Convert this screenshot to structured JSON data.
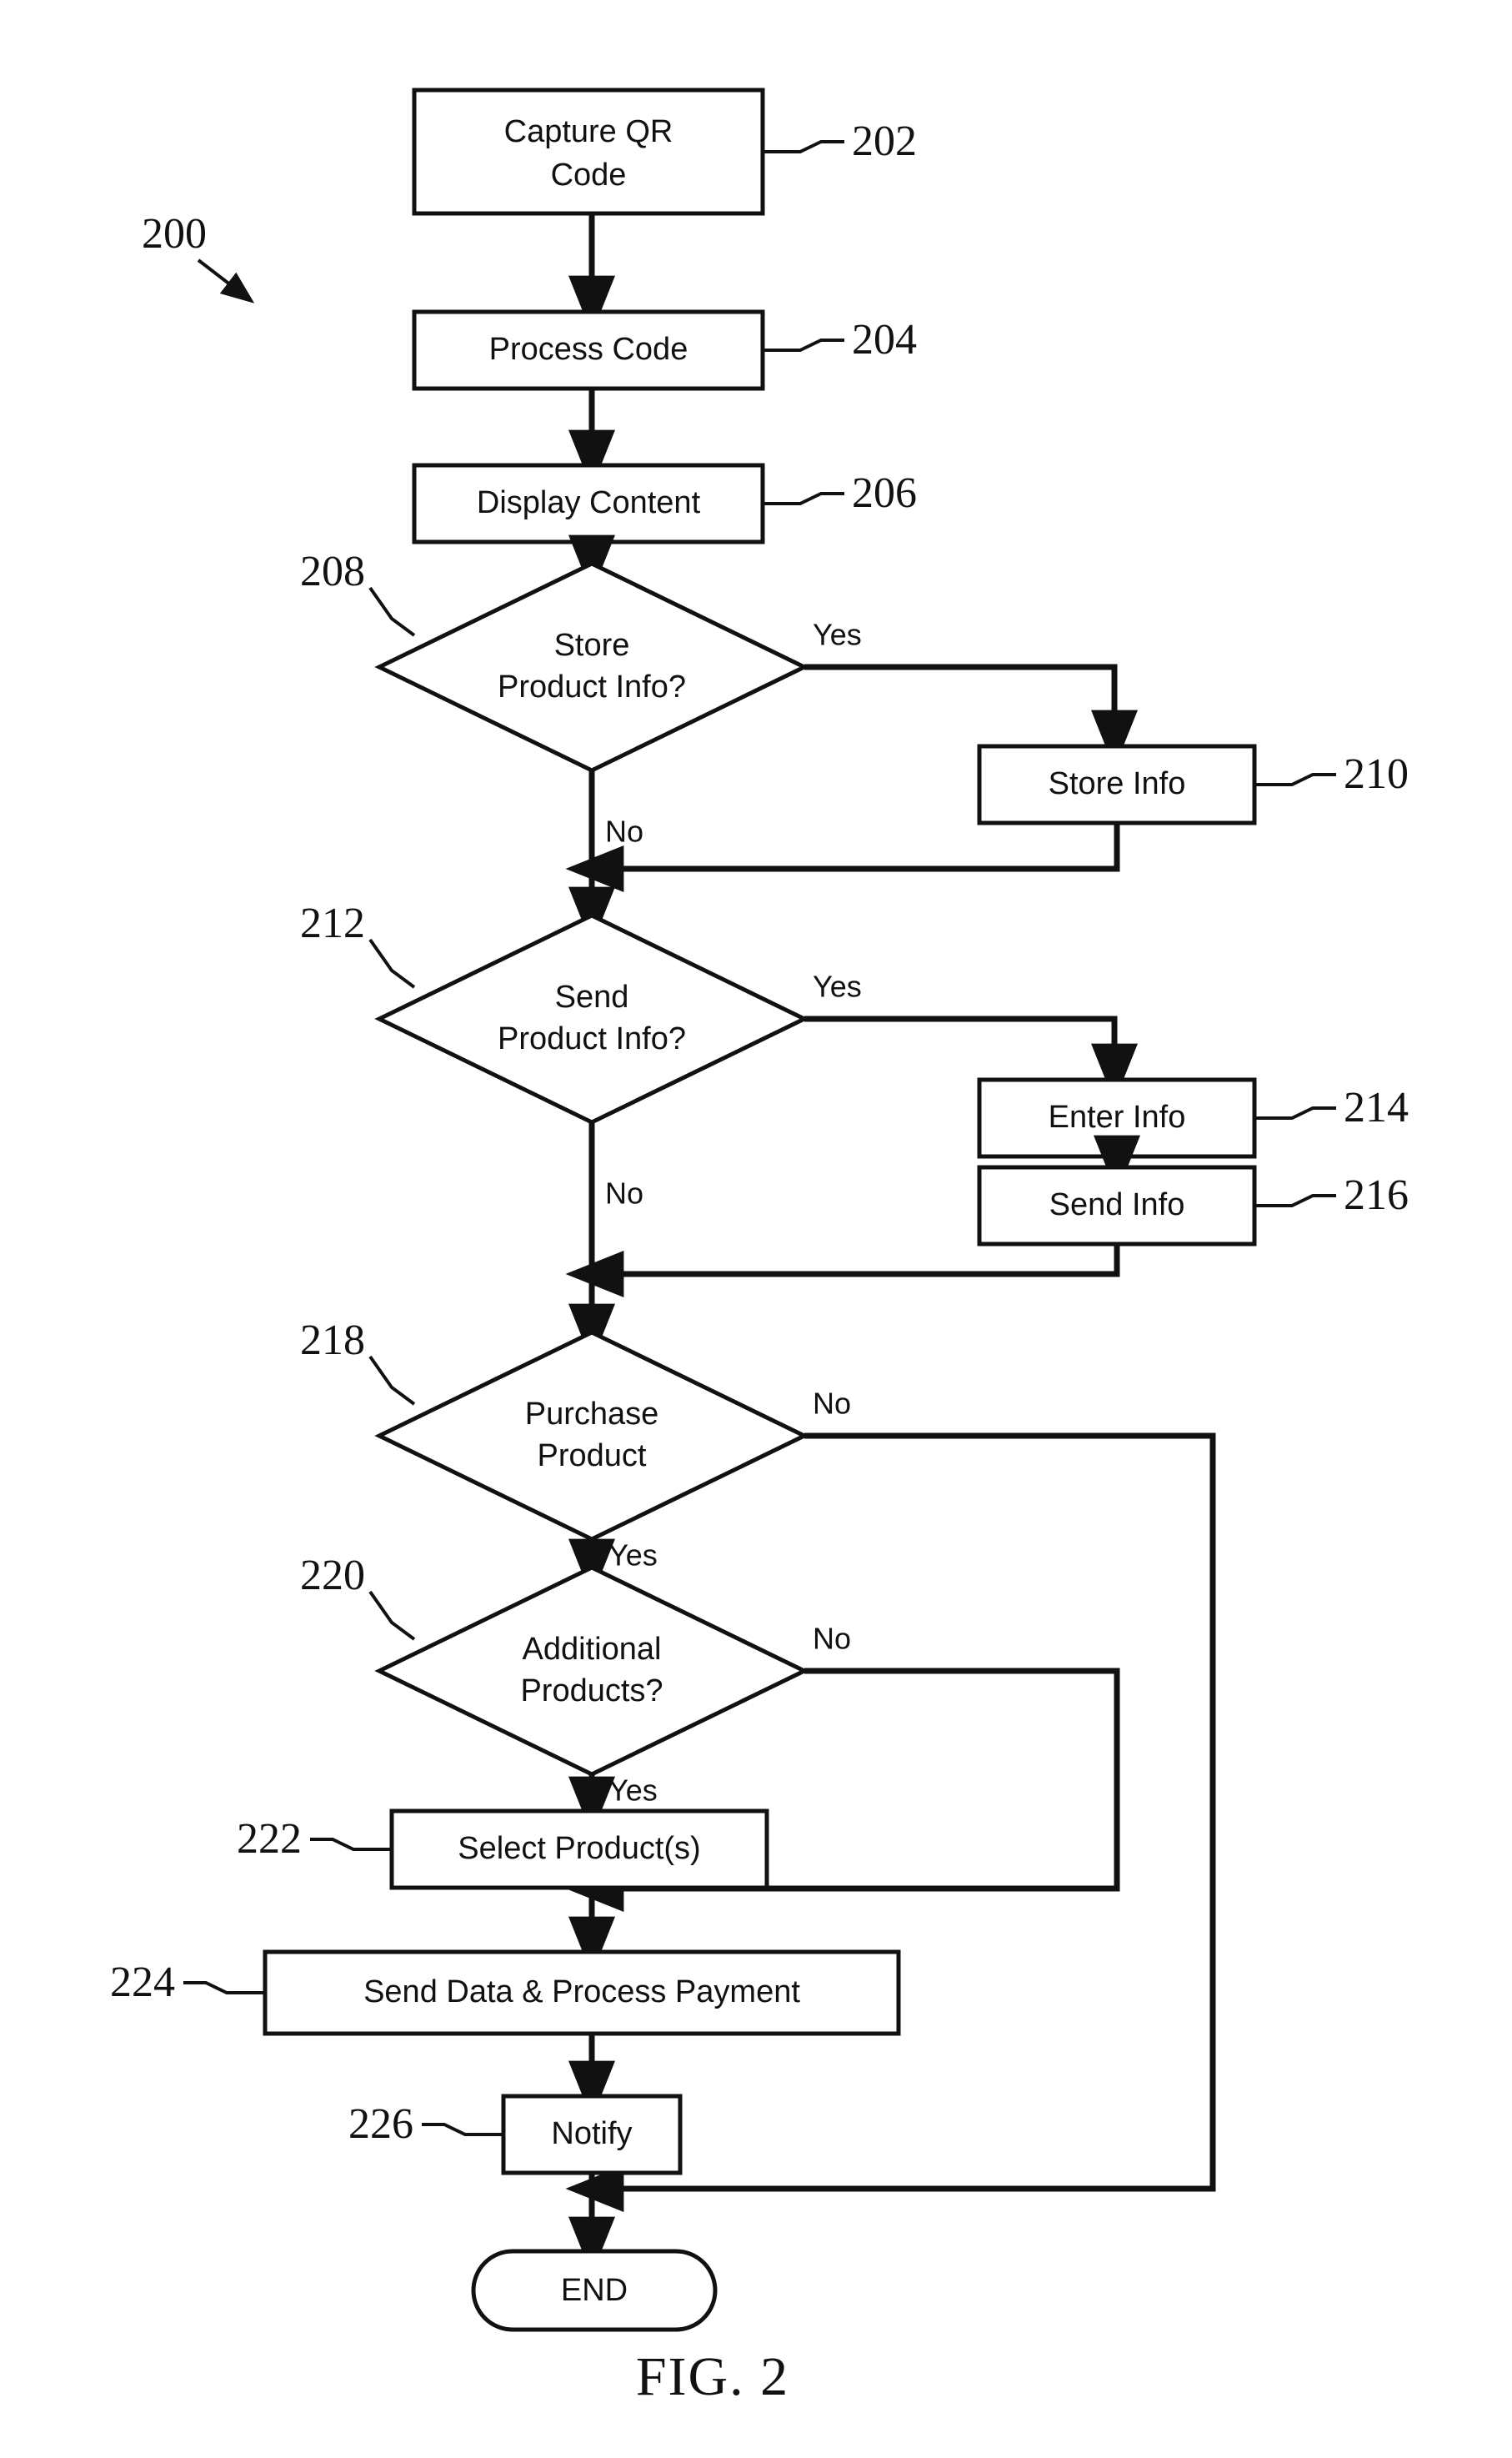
{
  "figure": {
    "caption": "FIG. 2",
    "diagram_ref": "200",
    "type": "flowchart"
  },
  "nodes": {
    "n202": {
      "ref": "202",
      "label_line1": "Capture QR",
      "label_line2": "Code",
      "shape": "process"
    },
    "n204": {
      "ref": "204",
      "label_line1": "Process Code",
      "shape": "process"
    },
    "n206": {
      "ref": "206",
      "label_line1": "Display Content",
      "shape": "process"
    },
    "n208": {
      "ref": "208",
      "label_line1": "Store",
      "label_line2": "Product Info?",
      "shape": "decision"
    },
    "n210": {
      "ref": "210",
      "label_line1": "Store Info",
      "shape": "process"
    },
    "n212": {
      "ref": "212",
      "label_line1": "Send",
      "label_line2": "Product Info?",
      "shape": "decision"
    },
    "n214": {
      "ref": "214",
      "label_line1": "Enter Info",
      "shape": "process"
    },
    "n216": {
      "ref": "216",
      "label_line1": "Send Info",
      "shape": "process"
    },
    "n218": {
      "ref": "218",
      "label_line1": "Purchase",
      "label_line2": "Product",
      "shape": "decision"
    },
    "n220": {
      "ref": "220",
      "label_line1": "Additional",
      "label_line2": "Products?",
      "shape": "decision"
    },
    "n222": {
      "ref": "222",
      "label_line1": "Select Product(s)",
      "shape": "process"
    },
    "n224": {
      "ref": "224",
      "label_line1": "Send Data & Process Payment",
      "shape": "process"
    },
    "n226": {
      "ref": "226",
      "label_line1": "Notify",
      "shape": "process"
    },
    "nend": {
      "label_line1": "END",
      "shape": "terminator"
    }
  },
  "branch_labels": {
    "b208_yes": "Yes",
    "b208_no": "No",
    "b212_yes": "Yes",
    "b212_no": "No",
    "b218_no": "No",
    "b218_yes": "Yes",
    "b220_no": "No",
    "b220_yes": "Yes"
  },
  "chart_data": {
    "type": "diagram",
    "title": "FIG. 2",
    "flow": [
      {
        "id": "202",
        "text": "Capture QR Code",
        "kind": "process",
        "next": "204"
      },
      {
        "id": "204",
        "text": "Process Code",
        "kind": "process",
        "next": "206"
      },
      {
        "id": "206",
        "text": "Display Content",
        "kind": "process",
        "next": "208"
      },
      {
        "id": "208",
        "text": "Store Product Info?",
        "kind": "decision",
        "yes": "210",
        "no": "212"
      },
      {
        "id": "210",
        "text": "Store Info",
        "kind": "process",
        "next": "212"
      },
      {
        "id": "212",
        "text": "Send Product Info?",
        "kind": "decision",
        "yes": "214",
        "no": "218"
      },
      {
        "id": "214",
        "text": "Enter Info",
        "kind": "process",
        "next": "216"
      },
      {
        "id": "216",
        "text": "Send Info",
        "kind": "process",
        "next": "218"
      },
      {
        "id": "218",
        "text": "Purchase Product",
        "kind": "decision",
        "yes": "220",
        "no": "END"
      },
      {
        "id": "220",
        "text": "Additional Products?",
        "kind": "decision",
        "yes": "222",
        "no": "224"
      },
      {
        "id": "222",
        "text": "Select Product(s)",
        "kind": "process",
        "next": "224"
      },
      {
        "id": "224",
        "text": "Send Data & Process Payment",
        "kind": "process",
        "next": "226"
      },
      {
        "id": "226",
        "text": "Notify",
        "kind": "process",
        "next": "END"
      },
      {
        "id": "END",
        "text": "END",
        "kind": "terminator"
      }
    ]
  }
}
